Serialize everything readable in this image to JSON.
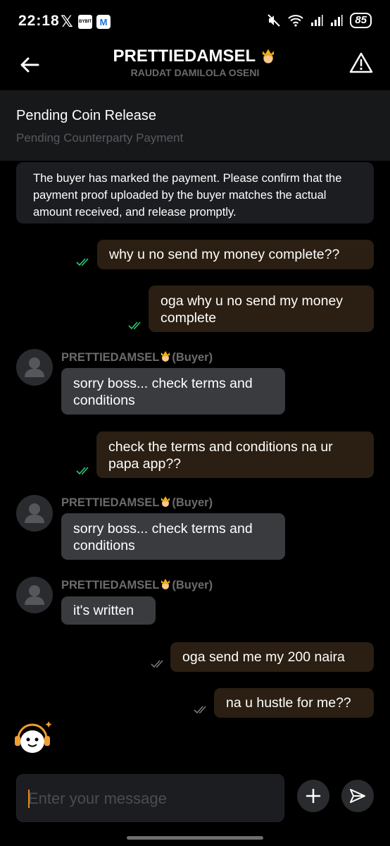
{
  "status_bar": {
    "time": "22:18",
    "battery": "85",
    "x_icon": "x-logo-icon",
    "bybit_label": "BYBIT",
    "m_label": "M"
  },
  "header": {
    "title": "PRETTIEDAMSEL",
    "subtitle": "RAUDAT DAMILOLA OSENI"
  },
  "order": {
    "status": "Pending Coin Release",
    "sub_status": "Pending Counterparty Payment"
  },
  "notice": "The buyer has marked the payment. Please confirm that the payment proof uploaded by the buyer matches the actual amount received, and release promptly.",
  "messages": [
    {
      "direction": "out",
      "text": "why u no send my money complete??",
      "read": true
    },
    {
      "direction": "out",
      "text": "oga why u no send my money complete",
      "read": true
    },
    {
      "direction": "in",
      "sender": "PRETTIEDAMSEL",
      "role": "(Buyer)",
      "text": "sorry boss... check terms and conditions"
    },
    {
      "direction": "out",
      "text": "check the terms and conditions  na ur papa app??",
      "read": true
    },
    {
      "direction": "in",
      "sender": "PRETTIEDAMSEL",
      "role": "(Buyer)",
      "text": "sorry boss... check terms and conditions"
    },
    {
      "direction": "in",
      "sender": "PRETTIEDAMSEL",
      "role": "(Buyer)",
      "text": "it's written"
    },
    {
      "direction": "out",
      "text": "oga send me my 200 naira",
      "read": false
    },
    {
      "direction": "out",
      "text": "na u hustle for me??",
      "read": false
    }
  ],
  "composer": {
    "placeholder": "Enter your message"
  },
  "colors": {
    "background": "#000000",
    "outgoing_bubble": "#2a1f12",
    "incoming_bubble": "#3a3b3f",
    "read_tick": "#2ecc71",
    "unread_tick": "#7a7a7a",
    "accent": "#f0a030"
  }
}
